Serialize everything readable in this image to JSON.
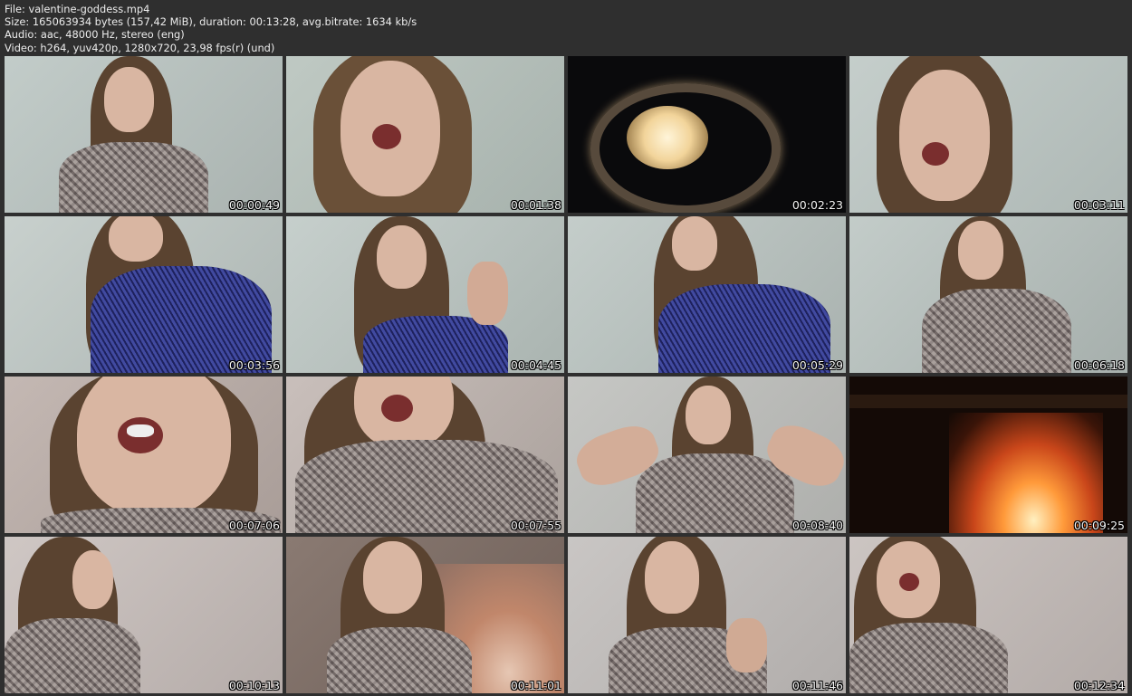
{
  "header": {
    "file_line": "File: valentine-goddess.mp4",
    "size_line": "Size: 165063934 bytes (157,42 MiB), duration: 00:13:28, avg.bitrate: 1634 kb/s",
    "audio_line": "Audio: aac, 48000 Hz, stereo (eng)",
    "video_line": "Video: h264, yuv420p, 1280x720, 23,98 fps(r) (und)"
  },
  "thumbnails": [
    {
      "timestamp": "00:00:49"
    },
    {
      "timestamp": "00:01:38"
    },
    {
      "timestamp": "00:02:23"
    },
    {
      "timestamp": "00:03:11"
    },
    {
      "timestamp": "00:03:56"
    },
    {
      "timestamp": "00:04:45"
    },
    {
      "timestamp": "00:05:29"
    },
    {
      "timestamp": "00:06:18"
    },
    {
      "timestamp": "00:07:06"
    },
    {
      "timestamp": "00:07:55"
    },
    {
      "timestamp": "00:08:40"
    },
    {
      "timestamp": "00:09:25"
    },
    {
      "timestamp": "00:10:13"
    },
    {
      "timestamp": "00:11:01"
    },
    {
      "timestamp": "00:11:46"
    },
    {
      "timestamp": "00:12:34"
    }
  ]
}
